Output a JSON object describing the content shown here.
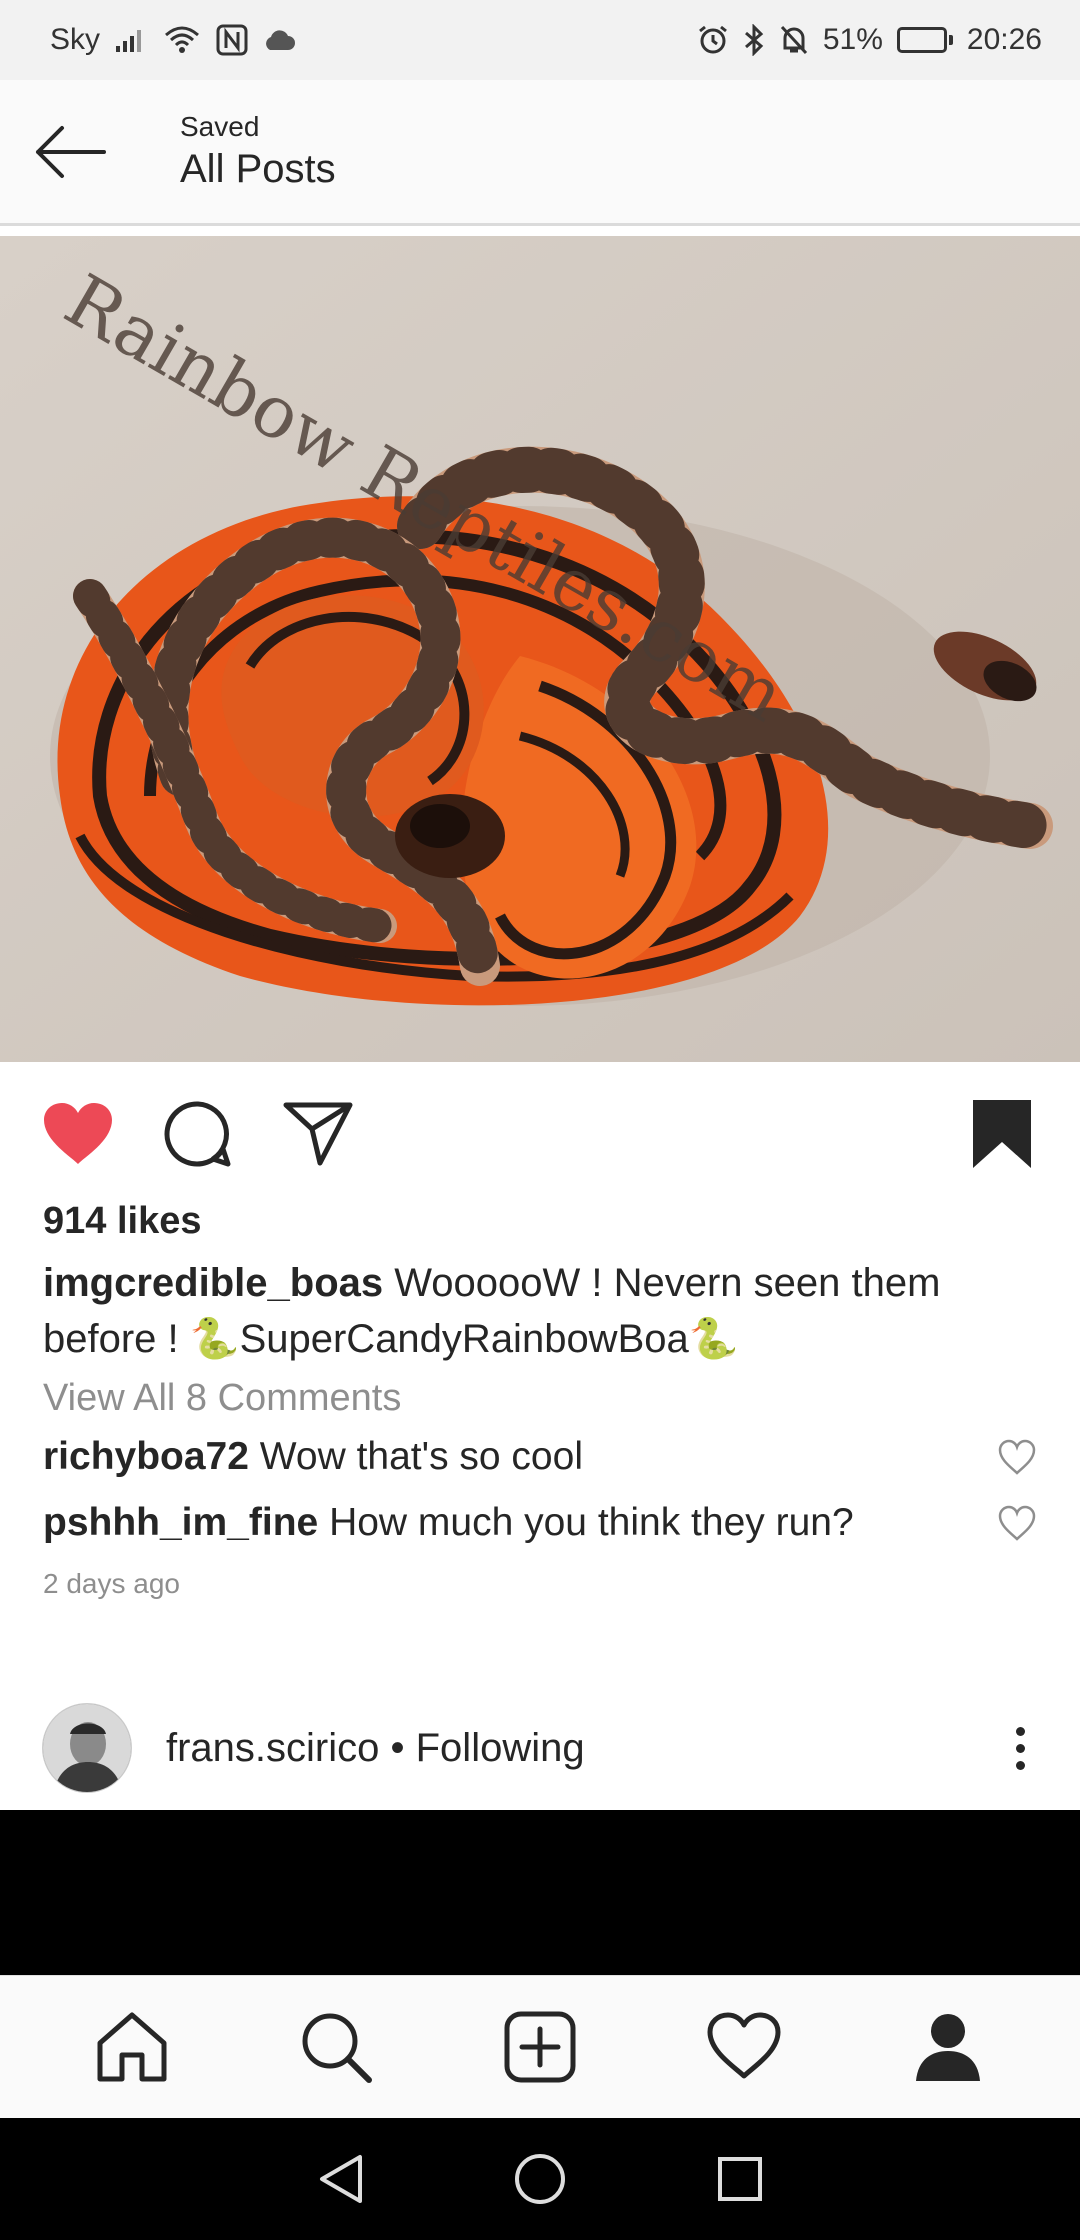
{
  "status_bar": {
    "carrier": "Sky",
    "battery_text": "51%",
    "battery_level": 0.51,
    "time": "20:26",
    "icons": [
      "signal-icon",
      "wifi-icon",
      "nfc-icon",
      "cloud-icon",
      "alarm-icon",
      "bluetooth-icon",
      "mute-icon",
      "battery-icon"
    ]
  },
  "header": {
    "subtitle": "Saved",
    "title": "All Posts"
  },
  "post": {
    "image_watermark": "Rainbow Reptiles.com",
    "liked": true,
    "saved": true,
    "likes": "914 likes",
    "author": "imgcredible_boas",
    "caption": "WoooooW ! Nevern seen them before ! 🐍SuperCandyRainbowBoa🐍",
    "view_comments": "View All 8 Comments",
    "comments": [
      {
        "user": "richyboa72",
        "text": "Wow that's so cool"
      },
      {
        "user": "pshhh_im_fine",
        "text": "How much you think they run?"
      }
    ],
    "time_ago": "2 days ago"
  },
  "next_post": {
    "user": "frans.scirico",
    "separator": " • ",
    "follow_status": "Following"
  },
  "tabs": [
    "home-icon",
    "search-icon",
    "new-post-icon",
    "activity-icon",
    "profile-icon"
  ],
  "colors": {
    "like_red": "#ed4956",
    "text": "#262626",
    "muted": "#8e8e8e",
    "snake_orange": "#e8561a"
  }
}
